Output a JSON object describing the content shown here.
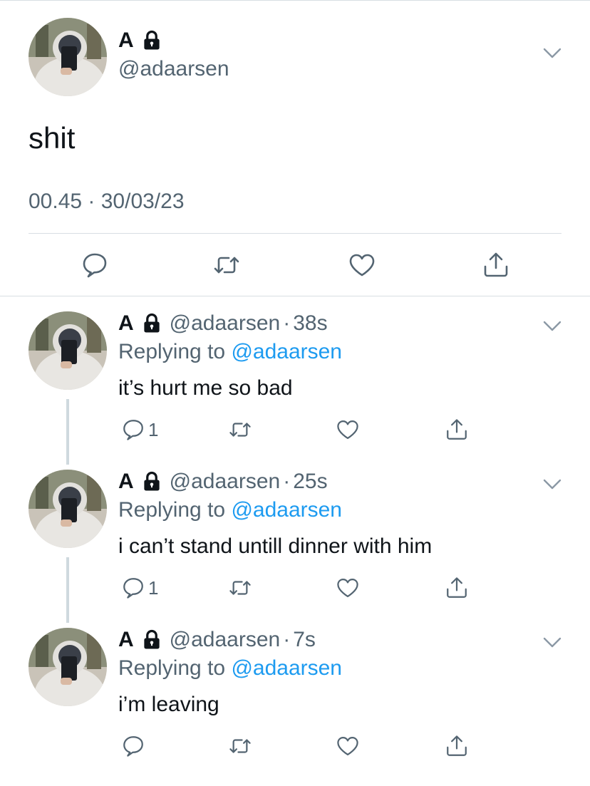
{
  "main_tweet": {
    "name": "A",
    "handle": "@adaarsen",
    "text": "shit",
    "timestamp": "00.45 · 30/03/23",
    "actions": [
      "reply-icon",
      "retweet-icon",
      "like-icon",
      "share-icon"
    ]
  },
  "replies": [
    {
      "name": "A",
      "handle": "@adaarsen",
      "dot": "·",
      "time": "38s",
      "replying_prefix": "Replying to",
      "replying_to": "@adaarsen",
      "text": "it’s hurt me so bad",
      "reply_count": "1"
    },
    {
      "name": "A",
      "handle": "@adaarsen",
      "dot": "·",
      "time": "25s",
      "replying_prefix": "Replying to",
      "replying_to": "@adaarsen",
      "text": "i can’t stand untill dinner with him",
      "reply_count": "1"
    },
    {
      "name": "A",
      "handle": "@adaarsen",
      "dot": "·",
      "time": "7s",
      "replying_prefix": "Replying to",
      "replying_to": "@adaarsen",
      "text": "i’m leaving",
      "reply_count": ""
    }
  ],
  "colors": {
    "text": "#0f1419",
    "secondary": "#536471",
    "link": "#1d9bf0",
    "divider": "#d8dee3",
    "thread_line": "#cfd9de"
  }
}
